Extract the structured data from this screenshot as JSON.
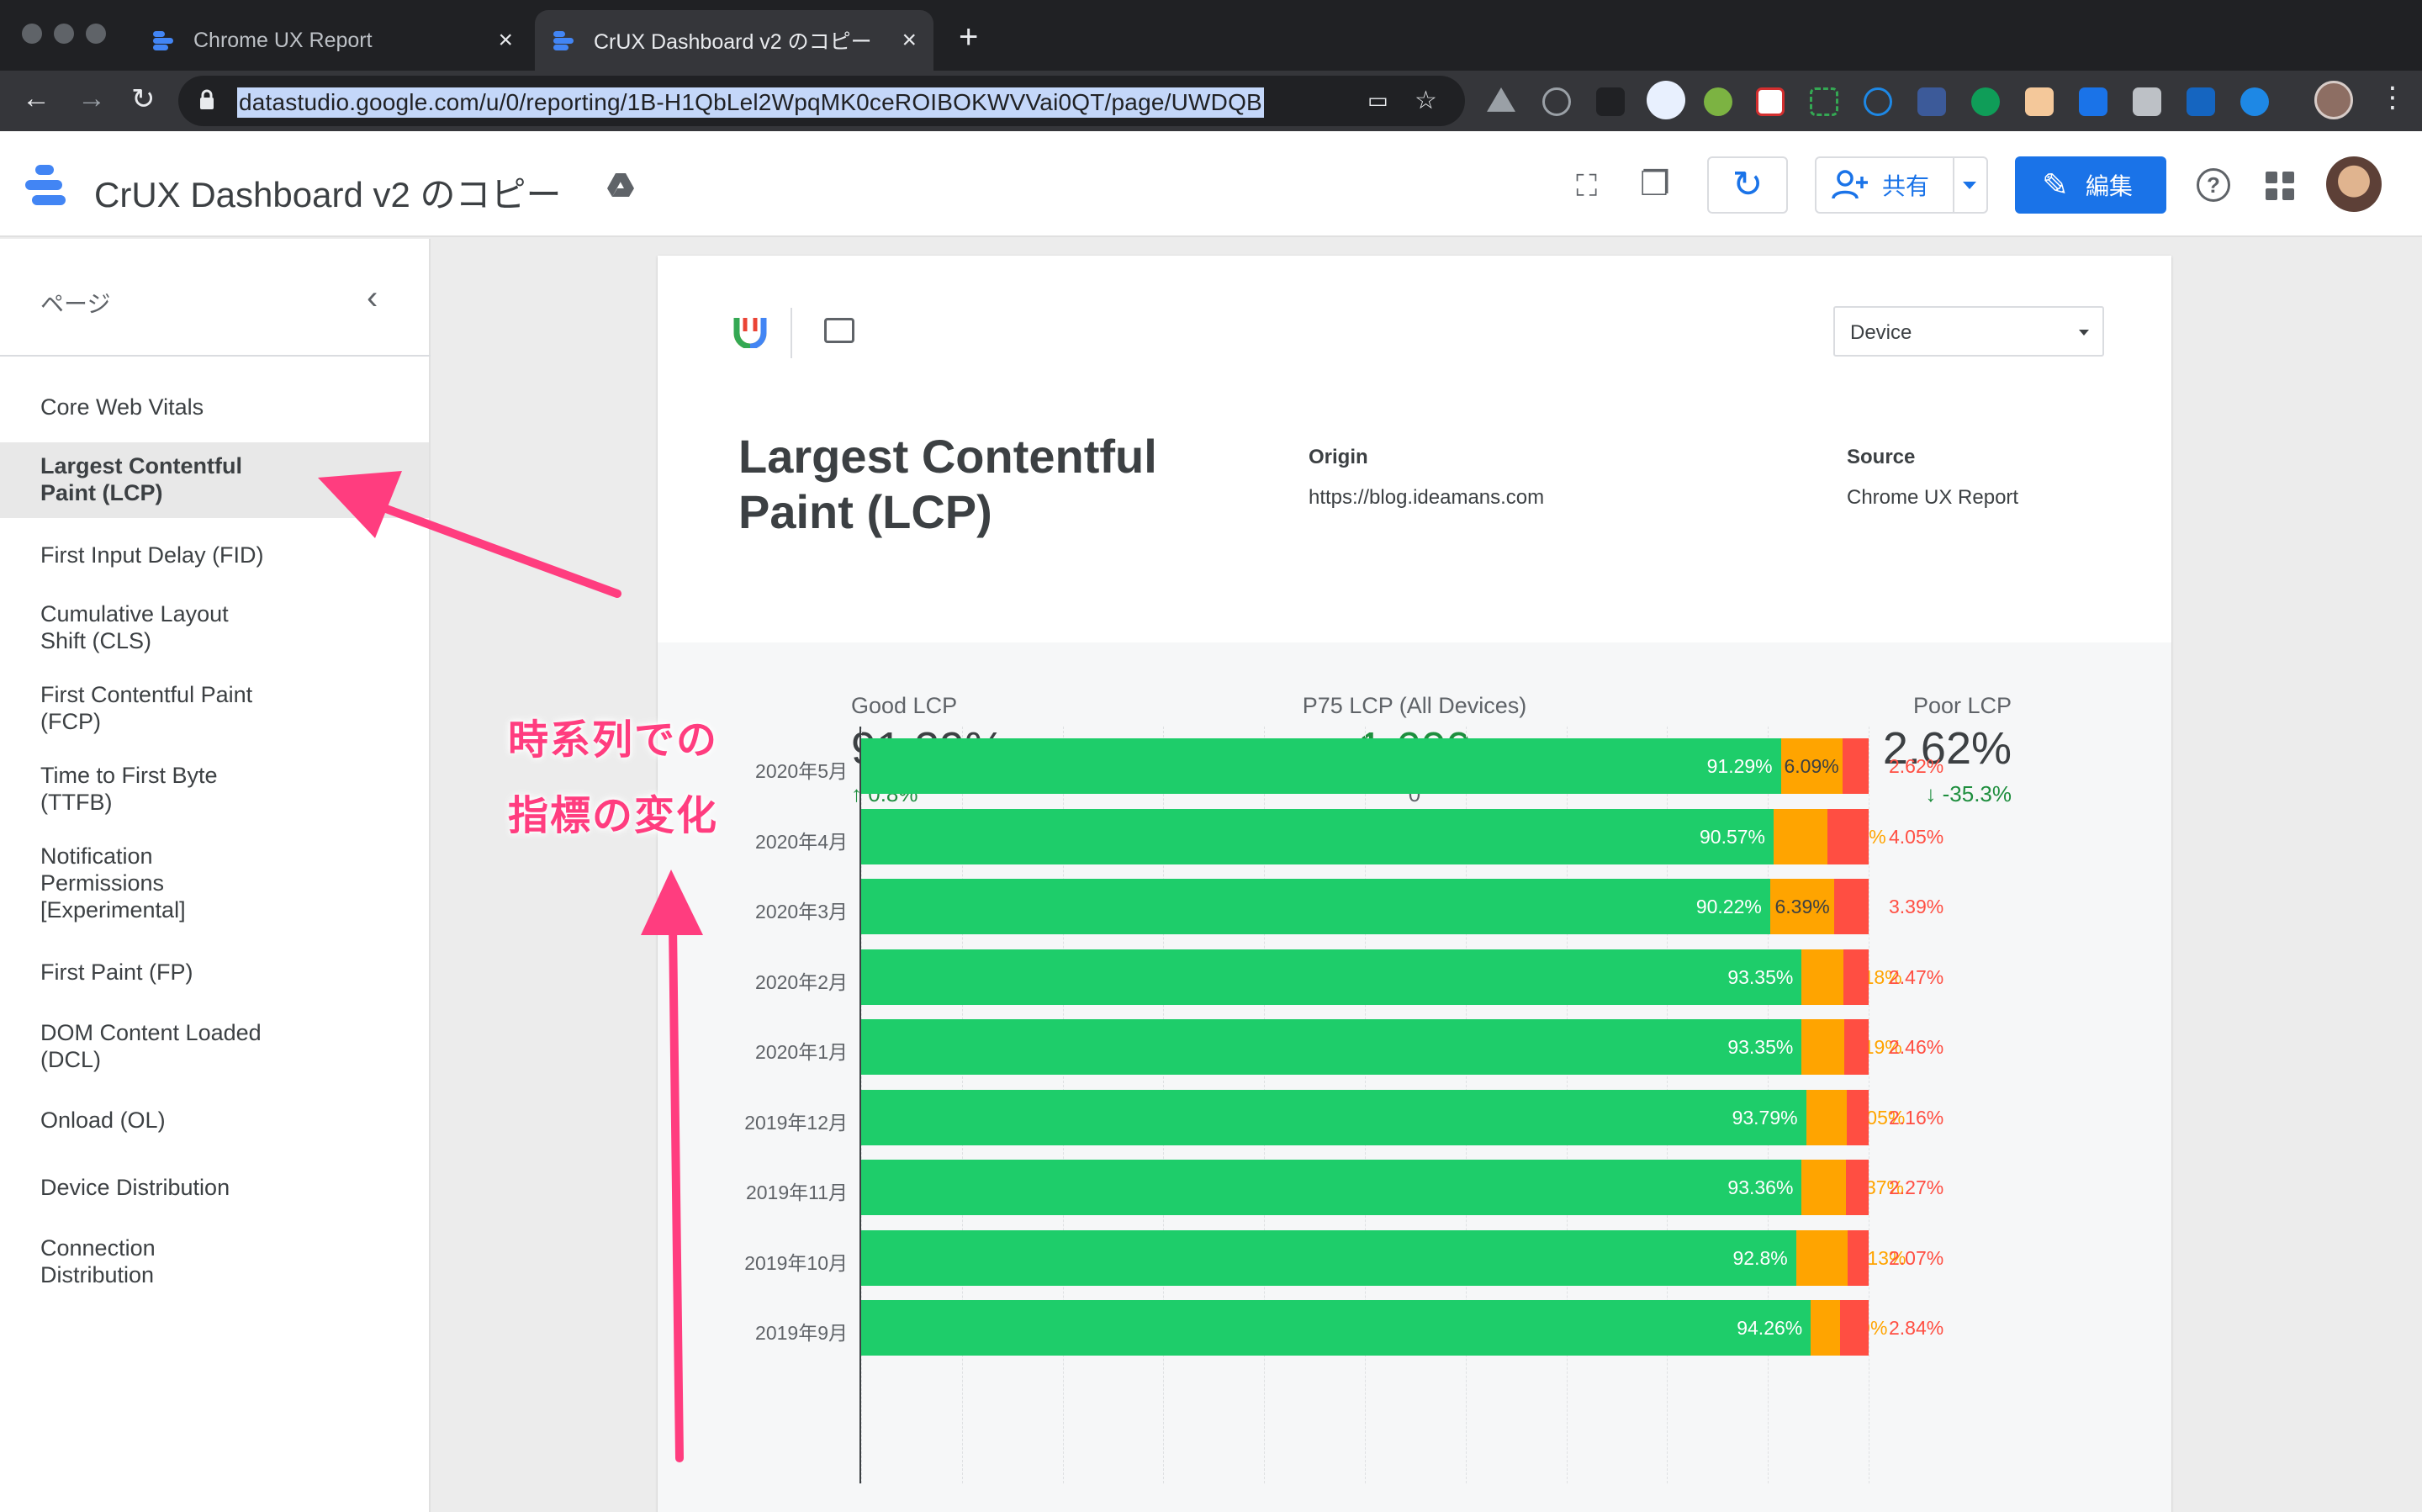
{
  "browser": {
    "tabs": [
      {
        "label": "Chrome UX Report",
        "active": false
      },
      {
        "label": "CrUX Dashboard v2 のコピー",
        "active": true
      }
    ],
    "url": "datastudio.google.com/u/0/reporting/1B-H1QbLel2WpqMK0ceROIBOKWVVai0QT/page/UWDQB"
  },
  "header": {
    "title": "CrUX Dashboard v2 のコピー",
    "share_label": "共有",
    "edit_label": "編集"
  },
  "sidebar": {
    "heading": "ページ",
    "items": [
      {
        "label": "Core Web Vitals"
      },
      {
        "label": "Largest Contentful Paint (LCP)",
        "active": true
      },
      {
        "label": "First Input Delay (FID)"
      },
      {
        "label": "Cumulative Layout Shift (CLS)"
      },
      {
        "label": "First Contentful Paint (FCP)"
      },
      {
        "label": "Time to First Byte (TTFB)"
      },
      {
        "label": "Notification Permissions [Experimental]"
      },
      {
        "label": "First Paint (FP)"
      },
      {
        "label": "DOM Content Loaded (DCL)"
      },
      {
        "label": "Onload (OL)"
      },
      {
        "label": "Device Distribution"
      },
      {
        "label": "Connection Distribution"
      }
    ]
  },
  "report": {
    "device_select": "Device",
    "metric_title": "Largest Contentful Paint (LCP)",
    "origin_label": "Origin",
    "origin_value": "https://blog.ideamans.com",
    "source_label": "Source",
    "source_value": "Chrome UX Report",
    "kpis": [
      {
        "label": "Good LCP",
        "value": "91.29%",
        "change": "0.8%",
        "trend": "up"
      },
      {
        "label": "P75 LCP (All Devices)",
        "value": "1,600",
        "change": "0",
        "trend": "none"
      },
      {
        "label": "Poor LCP",
        "value": "2.62%",
        "change": "-35.3%",
        "trend": "down"
      }
    ]
  },
  "annotation": {
    "line1": "時系列での",
    "line2": "指標の変化"
  },
  "colors": {
    "good": "#1ecd6a",
    "needs_improvement": "#ffa400",
    "poor": "#ff4e42",
    "accent": "#1a73e8",
    "annotation": "#ff3d7f"
  },
  "chart_data": {
    "type": "bar",
    "orientation": "horizontal",
    "stacked": true,
    "categories": [
      "2020年5月",
      "2020年4月",
      "2020年3月",
      "2020年2月",
      "2020年1月",
      "2019年12月",
      "2019年11月",
      "2019年10月",
      "2019年9月"
    ],
    "series": [
      {
        "values": [
          91.29,
          90.57,
          90.22,
          93.35,
          93.35,
          93.79,
          93.36,
          92.8,
          94.26
        ]
      },
      {
        "values": [
          6.09,
          5.38,
          6.39,
          4.18,
          4.19,
          4.05,
          4.37,
          5.13,
          2.9
        ]
      },
      {
        "values": [
          2.62,
          4.05,
          3.39,
          2.47,
          2.46,
          2.16,
          2.27,
          2.07,
          2.84
        ]
      }
    ],
    "labels": {
      "good": [
        "91.29%",
        "90.57%",
        "90.22%",
        "93.35%",
        "93.35%",
        "93.79%",
        "93.36%",
        "92.8%",
        "94.26%"
      ],
      "needs_improvement": [
        "6.09%",
        "5.38%",
        "6.39%",
        "4.18%",
        "4.19%",
        "4.05%",
        "4.37%",
        "5.13%",
        "2.9%"
      ],
      "poor": [
        "2.62%",
        "4.05%",
        "3.39%",
        "2.47%",
        "2.46%",
        "2.16%",
        "2.27%",
        "2.07%",
        "2.84%"
      ]
    },
    "xlim": [
      0,
      100
    ],
    "grid": true
  }
}
